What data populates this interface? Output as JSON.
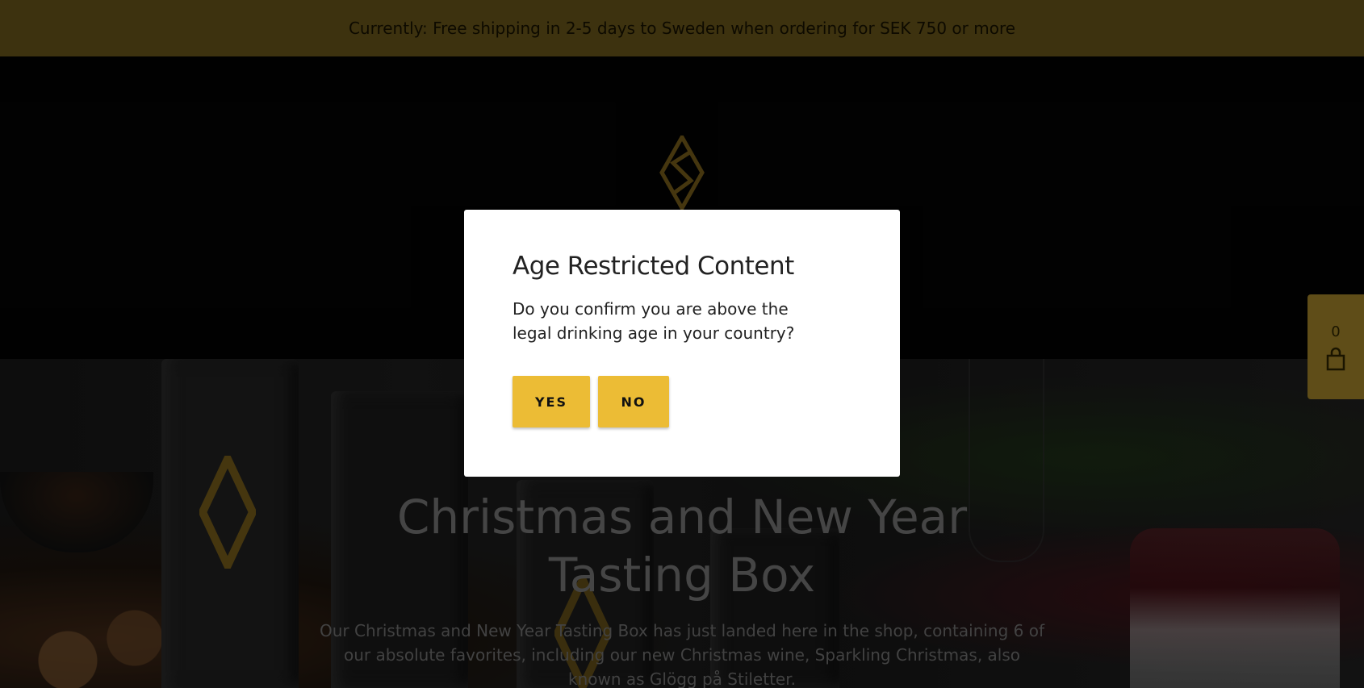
{
  "announcement": {
    "text": "Currently: Free shipping in 2-5 days to Sweden when ordering for SEK 750 or more",
    "background": "#5f4d18"
  },
  "header": {
    "logo_icon": "diamond-s-logo-icon",
    "logo_color": "#6b5418"
  },
  "hero": {
    "title": "Christmas and New Year Tasting Box",
    "text": "Our Christmas and New Year Tasting Box has just landed here in the shop, containing 6 of our absolute favorites, including our new Christmas wine, Sparkling Christmas, also known as Glögg på Stiletter."
  },
  "cart": {
    "count": "0",
    "icon": "shopping-bag-icon"
  },
  "age_modal": {
    "title": "Age Restricted Content",
    "text": "Do you confirm you are above the legal drinking age in your country?",
    "yes_label": "YES",
    "no_label": "NO",
    "button_color": "#ecbc35"
  }
}
